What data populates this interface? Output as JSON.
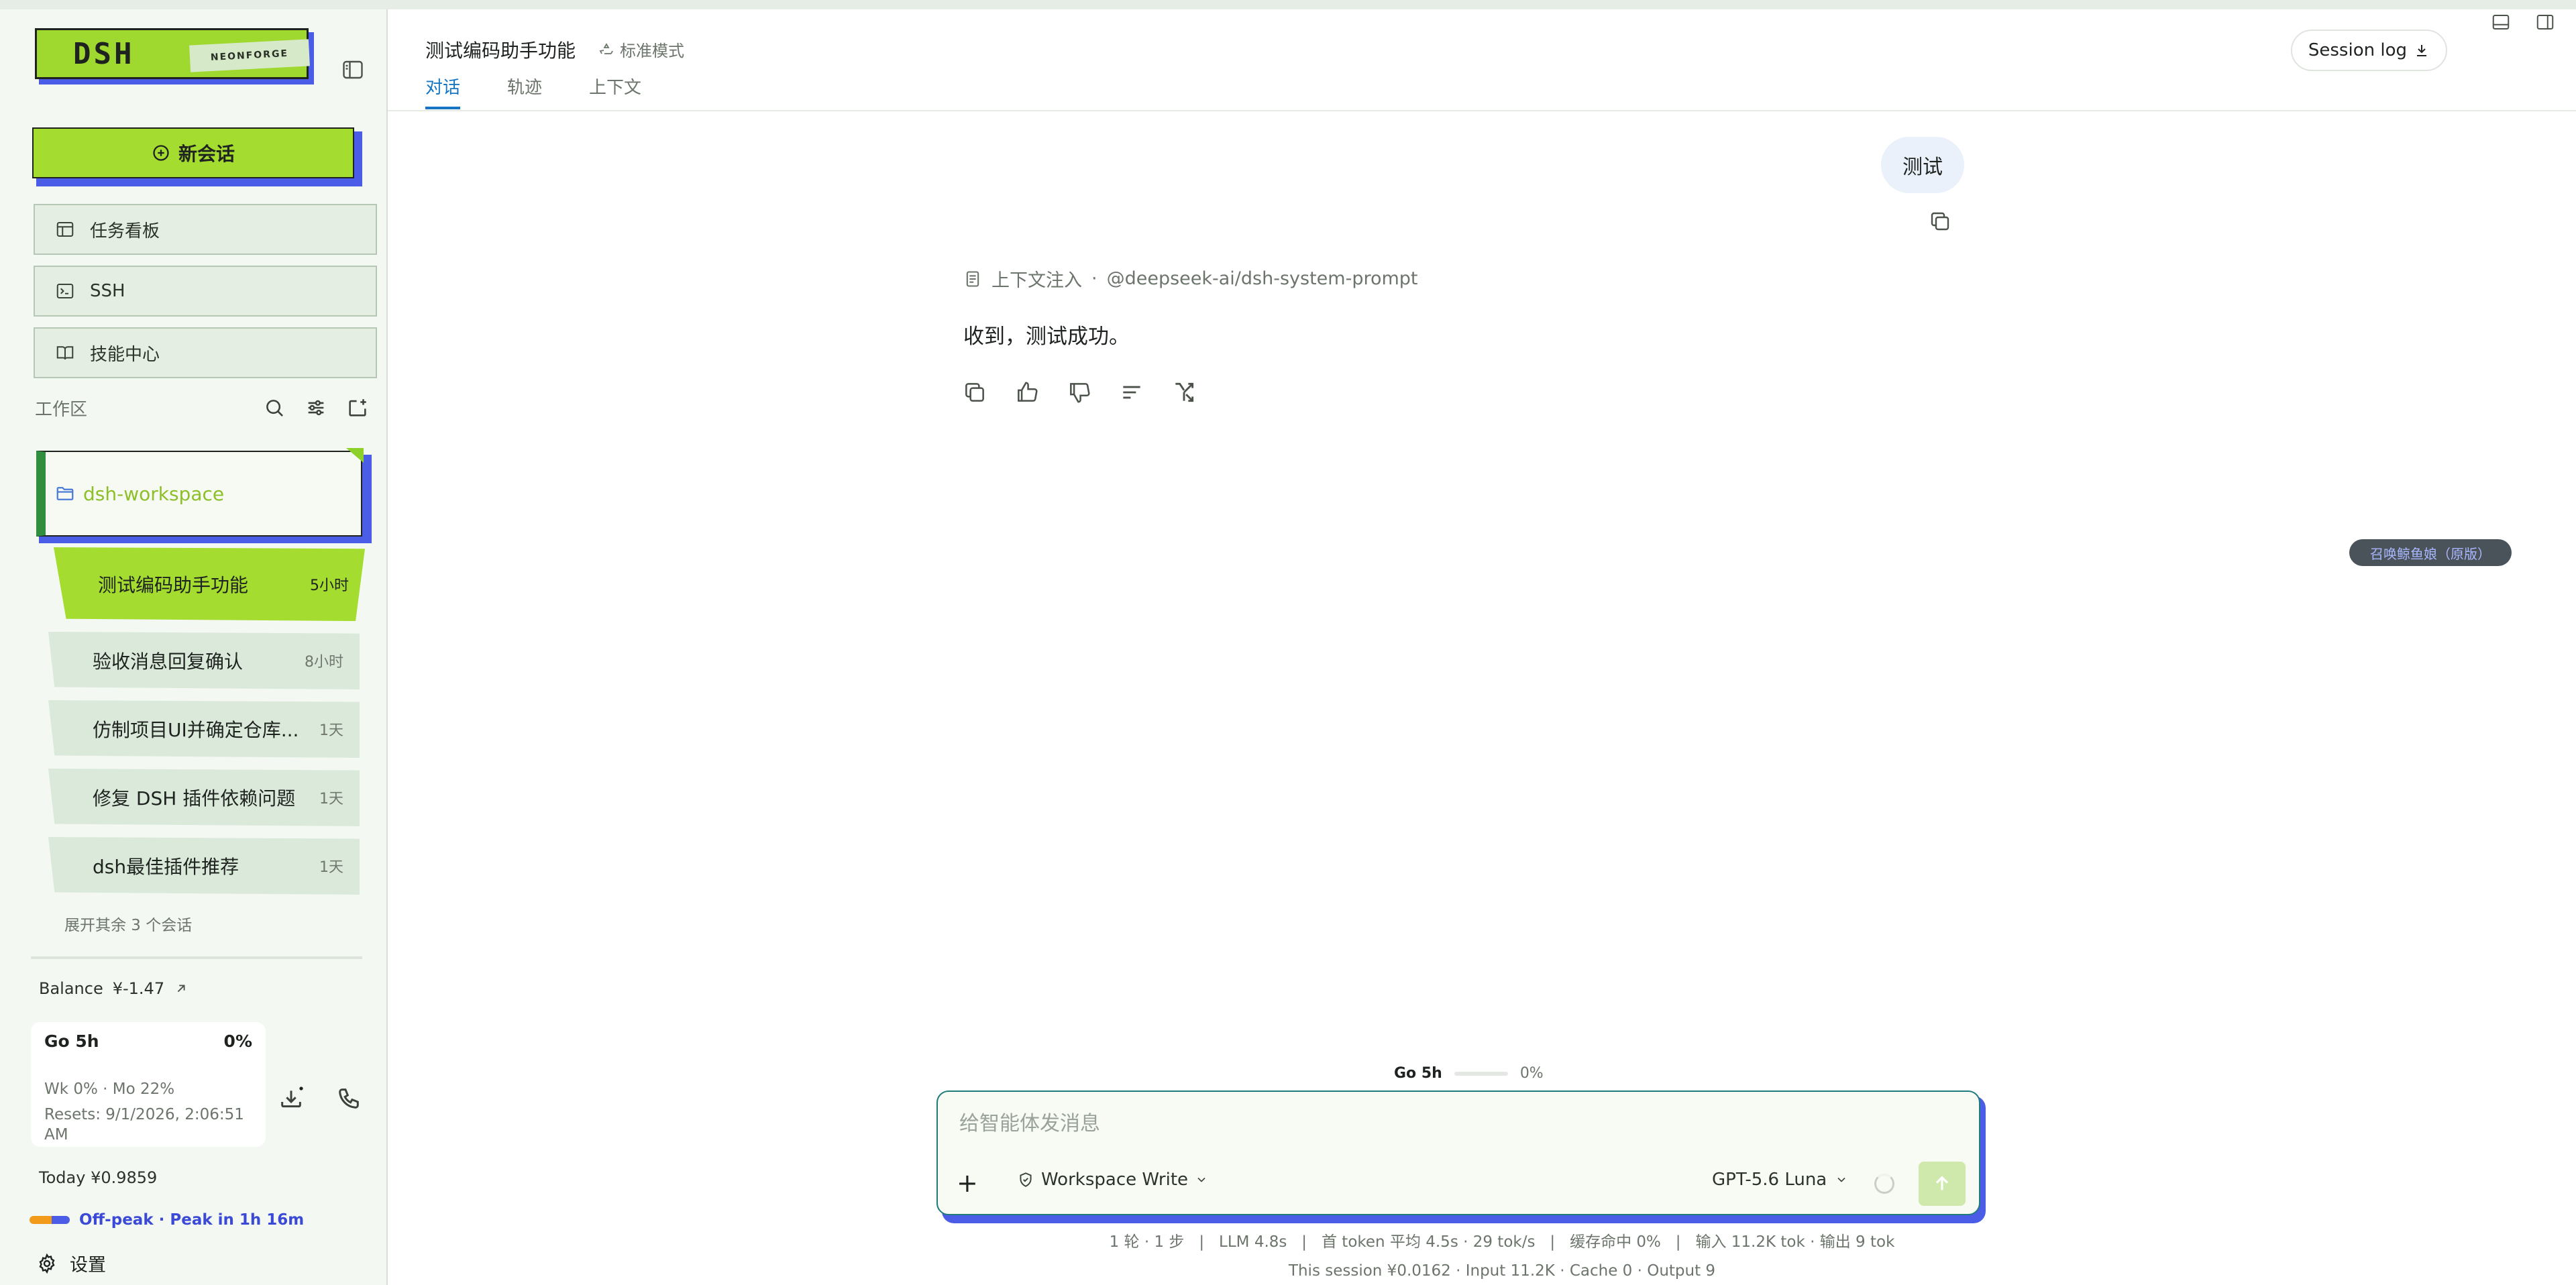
{
  "sidebar": {
    "logo": {
      "text": "DSH",
      "tag": "NEONFORGE"
    },
    "new_chat": "新会话",
    "nav": [
      {
        "label": "任务看板",
        "icon": "board-icon"
      },
      {
        "label": "SSH",
        "icon": "terminal-icon"
      },
      {
        "label": "技能中心",
        "icon": "book-icon"
      }
    ],
    "workspace_title": "工作区",
    "folder": "dsh-workspace",
    "chats": [
      {
        "title": "测试编码助手功能",
        "time": "5小时",
        "active": true
      },
      {
        "title": "验收消息回复确认",
        "time": "8小时"
      },
      {
        "title": "仿制项目UI并确定仓库...",
        "time": "1天"
      },
      {
        "title": "修复 DSH 插件依赖问题",
        "time": "1天"
      },
      {
        "title": "dsh最佳插件推荐",
        "time": "1天"
      }
    ],
    "expand": "展开其余 3 个会话",
    "balance_label": "Balance",
    "balance_value": "¥-1.47",
    "usage": {
      "title": "Go 5h",
      "pct": "0%",
      "line1": "Wk 0% · Mo 22%",
      "line2": "Resets: 9/1/2026, 2:06:51 AM"
    },
    "today_label": "Today",
    "today_value": "¥0.9859",
    "offpeak": "Off-peak · Peak in 1h 16m",
    "settings": "设置"
  },
  "header": {
    "title": "测试编码助手功能",
    "mode": "标准模式",
    "tabs": [
      "对话",
      "轨迹",
      "上下文"
    ],
    "session_log": "Session log"
  },
  "conversation": {
    "user_message": "测试",
    "context_label": "上下文注入",
    "context_source": "@deepseek-ai/dsh-system-prompt",
    "reply": "收到，测试成功。"
  },
  "floating_pill": "召唤鲸鱼娘（原版）",
  "composer": {
    "go_label": "Go 5h",
    "go_pct": "0%",
    "placeholder": "给智能体发消息",
    "permission": "Workspace Write",
    "model": "GPT-5.6 Luna"
  },
  "stats": {
    "line1": "1 轮 · 1 步   |   LLM 4.8s   |   首 token 平均 4.5s · 29 tok/s   |   缓存命中 0%   |   输入 11.2K tok · 输出 9 tok",
    "line2": "This session ¥0.0162 · Input 11.2K · Cache 0 · Output 9"
  },
  "colors": {
    "accent_green": "#a4dc2f",
    "accent_blue": "#4b5ce6",
    "tab_active": "#1676c4"
  }
}
